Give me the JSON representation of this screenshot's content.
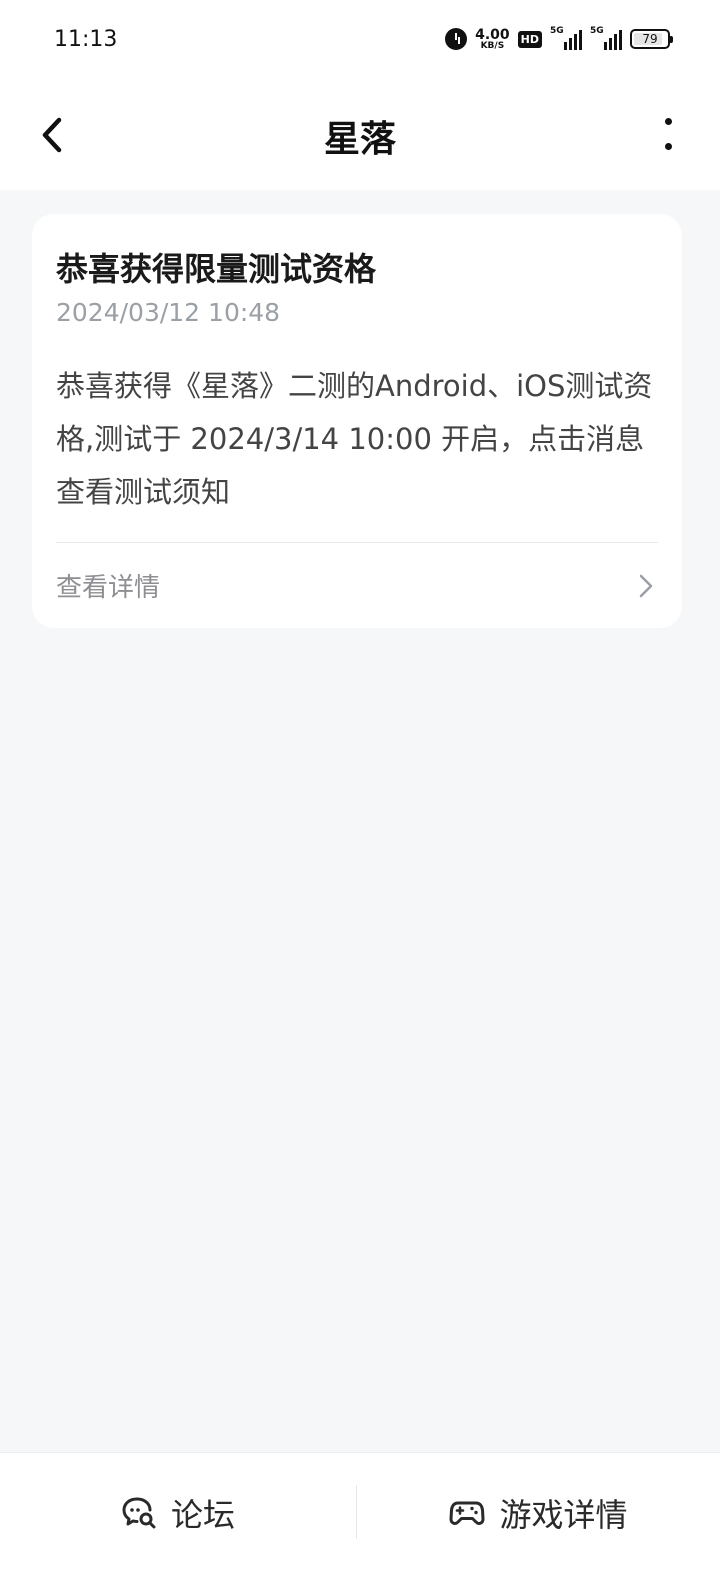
{
  "status_bar": {
    "time": "11:13",
    "net_speed_value": "4.00",
    "net_speed_unit": "KB/S",
    "hd_badge": "HD",
    "signal1_label": "5G",
    "signal2_label": "5G",
    "battery_level": "79",
    "icons": [
      "alarm-icon",
      "hd-icon",
      "signal-icon",
      "signal-icon",
      "battery-icon"
    ]
  },
  "header": {
    "title": "星落",
    "back_icon": "chevron-left-icon",
    "more_icon": "more-vertical-icon"
  },
  "message": {
    "title": "恭喜获得限量测试资格",
    "timestamp": "2024/03/12 10:48",
    "body": "恭喜获得《星落》二测的Android、iOS测试资格,测试于 2024/3/14 10:00 开启，点击消息查看测试须知",
    "link_label": "查看详情"
  },
  "bottom_bar": {
    "forum_label": "论坛",
    "forum_icon": "chat-search-icon",
    "game_label": "游戏详情",
    "game_icon": "gamepad-icon"
  },
  "colors": {
    "background": "#f5f7f9",
    "card": "#ffffff",
    "text_primary": "#1a1a1a",
    "text_secondary": "#9aa0a6"
  }
}
